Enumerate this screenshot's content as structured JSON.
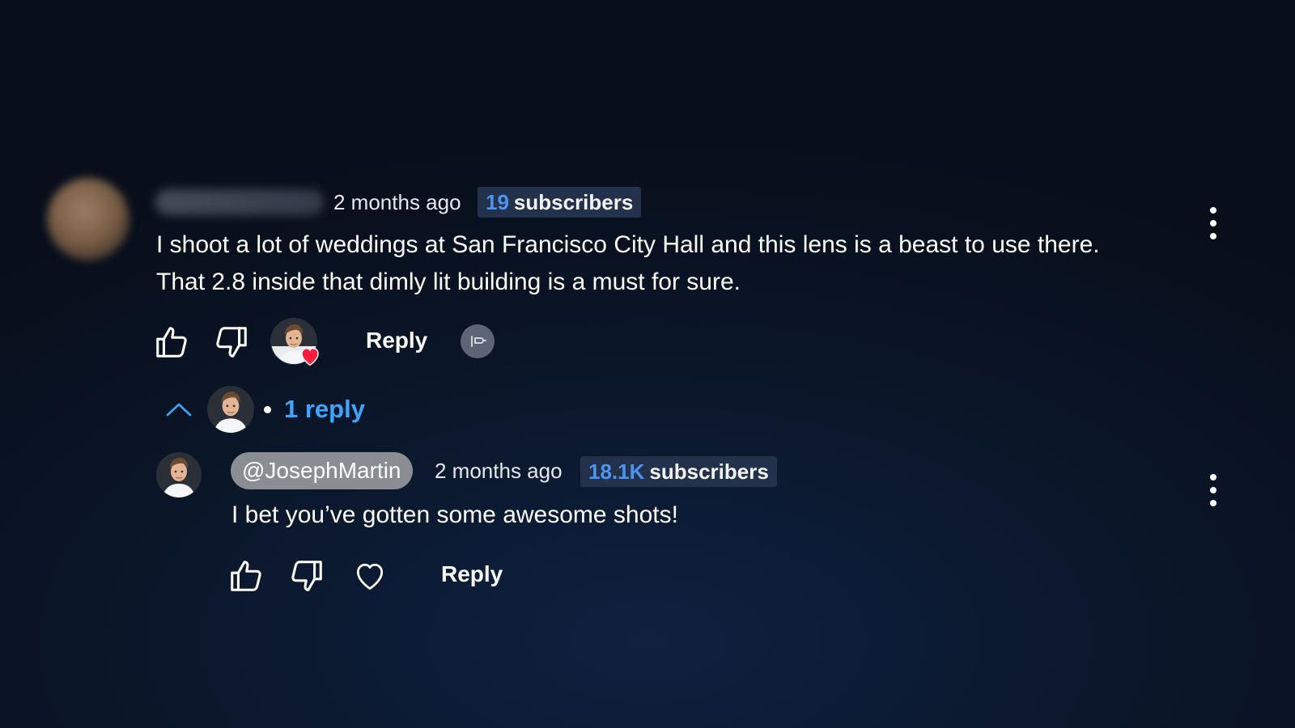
{
  "comment": {
    "time": "2 months ago",
    "subscriber_count": "19",
    "subscriber_label": "subscribers",
    "text_line_1": "I shoot a lot of weddings at San Francisco City Hall and this lens is a beast to use there.",
    "text_line_2": "That 2.8 inside that dimly lit building is a must for sure.",
    "reply_label": "Reply"
  },
  "replies_toggle": {
    "count_label": "1 reply"
  },
  "reply": {
    "handle": "@JosephMartin",
    "time": "2 months ago",
    "subscriber_count": "18.1K",
    "subscriber_label": "subscribers",
    "text": "I bet you’ve gotten some awesome shots!",
    "reply_label": "Reply"
  },
  "colors": {
    "accent": "#3ea6ff",
    "subscriber_count": "#4d93f0",
    "heart": "#ff1f3d"
  },
  "icons": {
    "like": "thumbs-up-icon",
    "dislike": "thumbs-down-icon",
    "heart": "heart-icon",
    "more": "more-vert-icon",
    "collapse": "chevron-up-icon",
    "music": "music-icon"
  }
}
